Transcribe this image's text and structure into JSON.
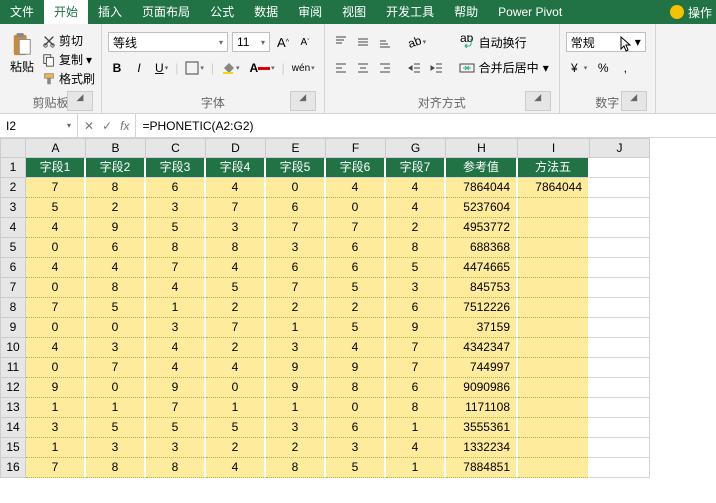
{
  "tabs": {
    "file": "文件",
    "home": "开始",
    "insert": "插入",
    "layout": "页面布局",
    "formula": "公式",
    "data": "数据",
    "review": "审阅",
    "view": "视图",
    "dev": "开发工具",
    "help": "帮助",
    "pivot": "Power Pivot",
    "oper": "操作"
  },
  "clipboard": {
    "label": "剪贴板",
    "paste": "粘贴",
    "cut": "剪切",
    "copy": "复制",
    "format": "格式刷"
  },
  "font": {
    "label": "字体",
    "name": "等线",
    "size": "11",
    "b": "B",
    "i": "I",
    "u": "U",
    "wen": "wén"
  },
  "align": {
    "label": "对齐方式",
    "wrap": "自动换行",
    "merge": "合并后居中"
  },
  "number": {
    "label": "数字",
    "format": "常规",
    "pct": "%",
    "comma": ","
  },
  "fbar": {
    "cell": "I2",
    "fx": "fx",
    "formula": "=PHONETIC(A2:G2)"
  },
  "cols": [
    "A",
    "B",
    "C",
    "D",
    "E",
    "F",
    "G",
    "H",
    "I",
    "J"
  ],
  "headers": [
    "字段1",
    "字段2",
    "字段3",
    "字段4",
    "字段5",
    "字段6",
    "字段7",
    "参考值",
    "方法五"
  ],
  "rows": [
    {
      "n": "2",
      "d": [
        "7",
        "8",
        "6",
        "4",
        "0",
        "4",
        "4",
        "7864044",
        "7864044"
      ]
    },
    {
      "n": "3",
      "d": [
        "5",
        "2",
        "3",
        "7",
        "6",
        "0",
        "4",
        "5237604",
        ""
      ]
    },
    {
      "n": "4",
      "d": [
        "4",
        "9",
        "5",
        "3",
        "7",
        "7",
        "2",
        "4953772",
        ""
      ]
    },
    {
      "n": "5",
      "d": [
        "0",
        "6",
        "8",
        "8",
        "3",
        "6",
        "8",
        "688368",
        ""
      ]
    },
    {
      "n": "6",
      "d": [
        "4",
        "4",
        "7",
        "4",
        "6",
        "6",
        "5",
        "4474665",
        ""
      ]
    },
    {
      "n": "7",
      "d": [
        "0",
        "8",
        "4",
        "5",
        "7",
        "5",
        "3",
        "845753",
        ""
      ]
    },
    {
      "n": "8",
      "d": [
        "7",
        "5",
        "1",
        "2",
        "2",
        "2",
        "6",
        "7512226",
        ""
      ]
    },
    {
      "n": "9",
      "d": [
        "0",
        "0",
        "3",
        "7",
        "1",
        "5",
        "9",
        "37159",
        ""
      ]
    },
    {
      "n": "10",
      "d": [
        "4",
        "3",
        "4",
        "2",
        "3",
        "4",
        "7",
        "4342347",
        ""
      ]
    },
    {
      "n": "11",
      "d": [
        "0",
        "7",
        "4",
        "4",
        "9",
        "9",
        "7",
        "744997",
        ""
      ]
    },
    {
      "n": "12",
      "d": [
        "9",
        "0",
        "9",
        "0",
        "9",
        "8",
        "6",
        "9090986",
        ""
      ]
    },
    {
      "n": "13",
      "d": [
        "1",
        "1",
        "7",
        "1",
        "1",
        "0",
        "8",
        "1171108",
        ""
      ]
    },
    {
      "n": "14",
      "d": [
        "3",
        "5",
        "5",
        "5",
        "3",
        "6",
        "1",
        "3555361",
        ""
      ]
    },
    {
      "n": "15",
      "d": [
        "1",
        "3",
        "3",
        "2",
        "2",
        "3",
        "4",
        "1332234",
        ""
      ]
    },
    {
      "n": "16",
      "d": [
        "7",
        "8",
        "8",
        "4",
        "8",
        "5",
        "1",
        "7884851",
        ""
      ]
    }
  ],
  "chart_data": {
    "type": "table",
    "title": "",
    "columns": [
      "字段1",
      "字段2",
      "字段3",
      "字段4",
      "字段5",
      "字段6",
      "字段7",
      "参考值",
      "方法五"
    ],
    "data": [
      [
        7,
        8,
        6,
        4,
        0,
        4,
        4,
        7864044,
        7864044
      ],
      [
        5,
        2,
        3,
        7,
        6,
        0,
        4,
        5237604,
        null
      ],
      [
        4,
        9,
        5,
        3,
        7,
        7,
        2,
        4953772,
        null
      ],
      [
        0,
        6,
        8,
        8,
        3,
        6,
        8,
        688368,
        null
      ],
      [
        4,
        4,
        7,
        4,
        6,
        6,
        5,
        4474665,
        null
      ],
      [
        0,
        8,
        4,
        5,
        7,
        5,
        3,
        845753,
        null
      ],
      [
        7,
        5,
        1,
        2,
        2,
        2,
        6,
        7512226,
        null
      ],
      [
        0,
        0,
        3,
        7,
        1,
        5,
        9,
        37159,
        null
      ],
      [
        4,
        3,
        4,
        2,
        3,
        4,
        7,
        4342347,
        null
      ],
      [
        0,
        7,
        4,
        4,
        9,
        9,
        7,
        744997,
        null
      ],
      [
        9,
        0,
        9,
        0,
        9,
        8,
        6,
        9090986,
        null
      ],
      [
        1,
        1,
        7,
        1,
        1,
        0,
        8,
        1171108,
        null
      ],
      [
        3,
        5,
        5,
        5,
        3,
        6,
        1,
        3555361,
        null
      ],
      [
        1,
        3,
        3,
        2,
        2,
        3,
        4,
        1332234,
        null
      ],
      [
        7,
        8,
        8,
        4,
        8,
        5,
        1,
        7884851,
        null
      ]
    ]
  }
}
